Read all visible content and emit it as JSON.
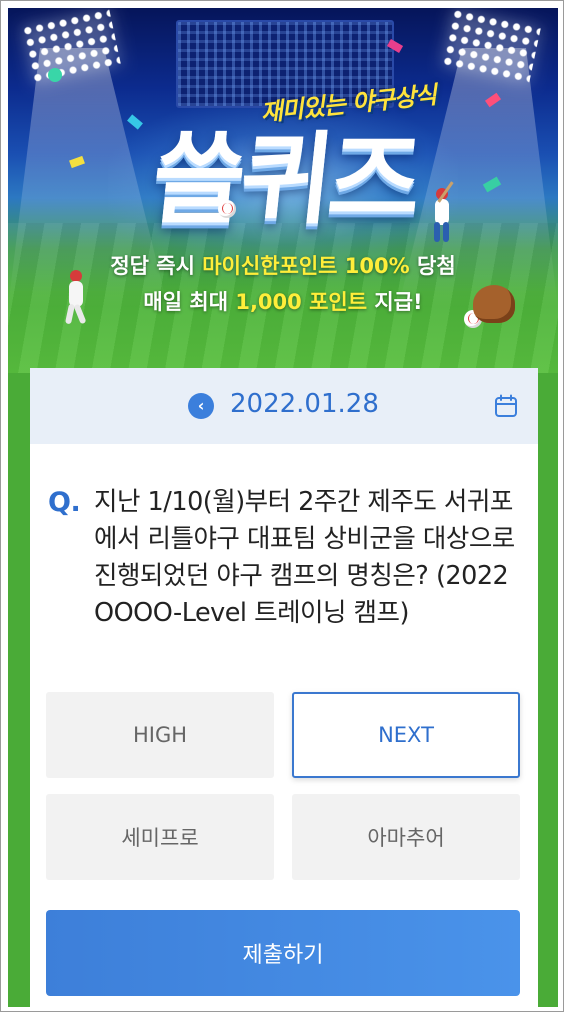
{
  "banner": {
    "subtitle": "재미있는 야구상식",
    "title": "쓸퀴즈",
    "promo_line1_pre": "정답 즉시 ",
    "promo_line1_hl": "마이신한포인트 100%",
    "promo_line1_post": " 당첨",
    "promo_line2_pre": "매일 최대 ",
    "promo_line2_hl": "1,000 포인트",
    "promo_line2_post": " 지급!"
  },
  "date_bar": {
    "prev_icon": "chevron-left-icon",
    "prev_glyph": "‹",
    "date": "2022.01.28",
    "calendar_icon": "calendar-icon"
  },
  "question": {
    "marker": "Q.",
    "text": "지난 1/10(월)부터 2주간 제주도 서귀포에서 리틀야구 대표팀 상비군을 대상으로 진행되었던 야구 캠프의 명칭은? (2022 OOOO-Level 트레이닝 캠프)"
  },
  "options": [
    {
      "label": "HIGH",
      "selected": false
    },
    {
      "label": "NEXT",
      "selected": true
    },
    {
      "label": "세미프로",
      "selected": false
    },
    {
      "label": "아마추어",
      "selected": false
    }
  ],
  "submit_label": "제출하기",
  "colors": {
    "accent": "#2f6fcd",
    "field_green": "#4aab37",
    "date_bar_bg": "#e8eff8",
    "option_bg": "#f2f2f2",
    "highlight_yellow": "#ffee3a"
  }
}
